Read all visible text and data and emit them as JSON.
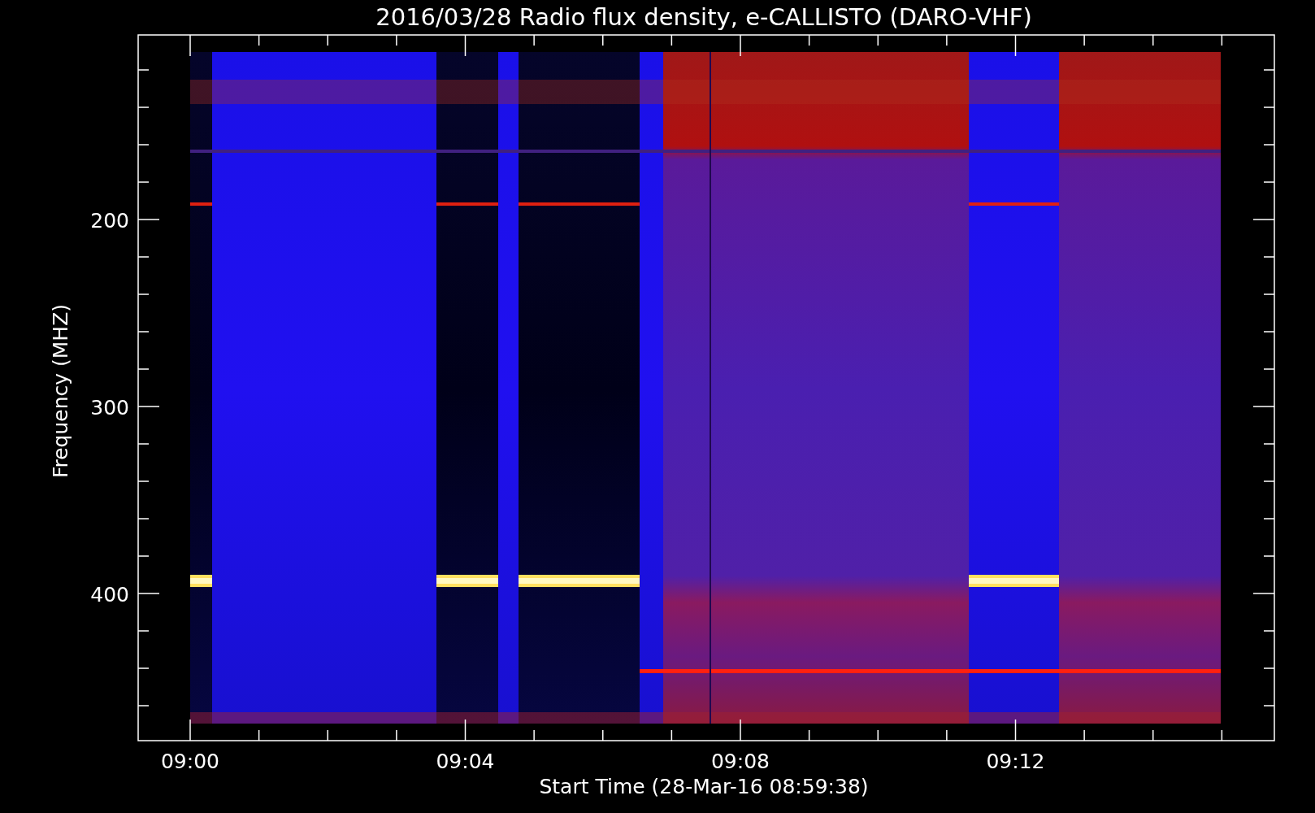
{
  "plot": {
    "title": "2016/03/28  Radio flux density, e-CALLISTO (DARO-VHF)",
    "xlabel": "Start Time (28-Mar-16 08:59:38)",
    "ylabel": "Frequency (MHZ)",
    "xtick_labels": [
      "09:00",
      "09:04",
      "09:08",
      "09:12"
    ],
    "ytick_labels": [
      "200",
      "300",
      "400"
    ]
  }
}
